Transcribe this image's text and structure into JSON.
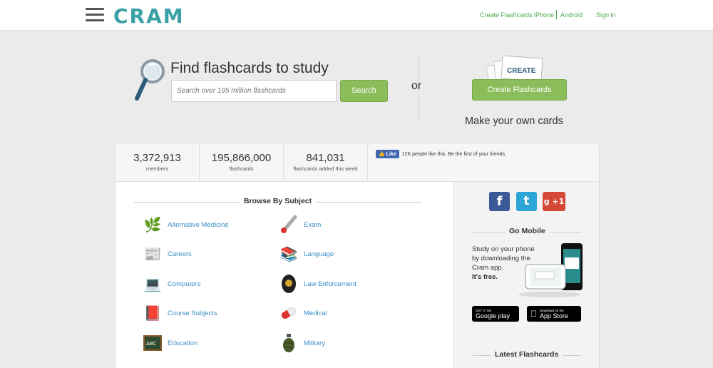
{
  "header": {
    "logo": "CRAM",
    "links": {
      "create_flashcards": "Create Flashcards",
      "iphone": "iPhone",
      "android": "Android",
      "sign_in": "Sign in"
    }
  },
  "hero": {
    "title": "Find flashcards to study",
    "search_placeholder": "Search over 195 million flashcards",
    "search_button": "Search",
    "or": "or",
    "create_card_label": "CREATE",
    "create_button": "Create Flashcards",
    "make_own": "Make your own cards"
  },
  "stats": [
    {
      "number": "3,372,913",
      "label": "members"
    },
    {
      "number": "195,866,000",
      "label": "flashcards"
    },
    {
      "number": "841,031",
      "label": "flashcards added this week"
    }
  ],
  "facebook": {
    "like_button": "Like",
    "text": "12K people like this. Be the first of your friends."
  },
  "browse": {
    "heading": "Browse By Subject",
    "left_column": [
      {
        "label": "Alternative Medicine",
        "icon": "herbs-icon"
      },
      {
        "label": "Careers",
        "icon": "jobs-newspaper-icon"
      },
      {
        "label": "Computers",
        "icon": "computer-icon"
      },
      {
        "label": "Course Subjects",
        "icon": "books-icon"
      },
      {
        "label": "Education",
        "icon": "chalkboard-icon"
      }
    ],
    "right_column": [
      {
        "label": "Exam",
        "icon": "thermometer-icon"
      },
      {
        "label": "Language",
        "icon": "dictionary-stack-icon"
      },
      {
        "label": "Law Enforcement",
        "icon": "police-badge-icon"
      },
      {
        "label": "Medical",
        "icon": "pill-icon"
      },
      {
        "label": "Military",
        "icon": "grenade-icon"
      }
    ]
  },
  "sidebar": {
    "social": [
      {
        "icon": "facebook-icon",
        "glyph": "f",
        "color": "#3b5998"
      },
      {
        "icon": "twitter-icon",
        "glyph": "t",
        "color": "#2ba4d6"
      },
      {
        "icon": "google-plus-icon",
        "glyph": "g +1",
        "color": "#d34836"
      }
    ],
    "go_mobile_heading": "Go Mobile",
    "go_mobile_text": "Study on your phone by downloading the Cram app.",
    "its_free": "It's free.",
    "google_play": {
      "small": "GET IT ON",
      "large": "Google play"
    },
    "app_store": {
      "small": "Download on the",
      "large": "App Store"
    },
    "latest_heading": "Latest Flashcards"
  },
  "colors": {
    "brand": "#3aa0a6",
    "green_button": "#8bbd5a",
    "link": "#3a8fc4",
    "header_link": "#4aa84a"
  }
}
